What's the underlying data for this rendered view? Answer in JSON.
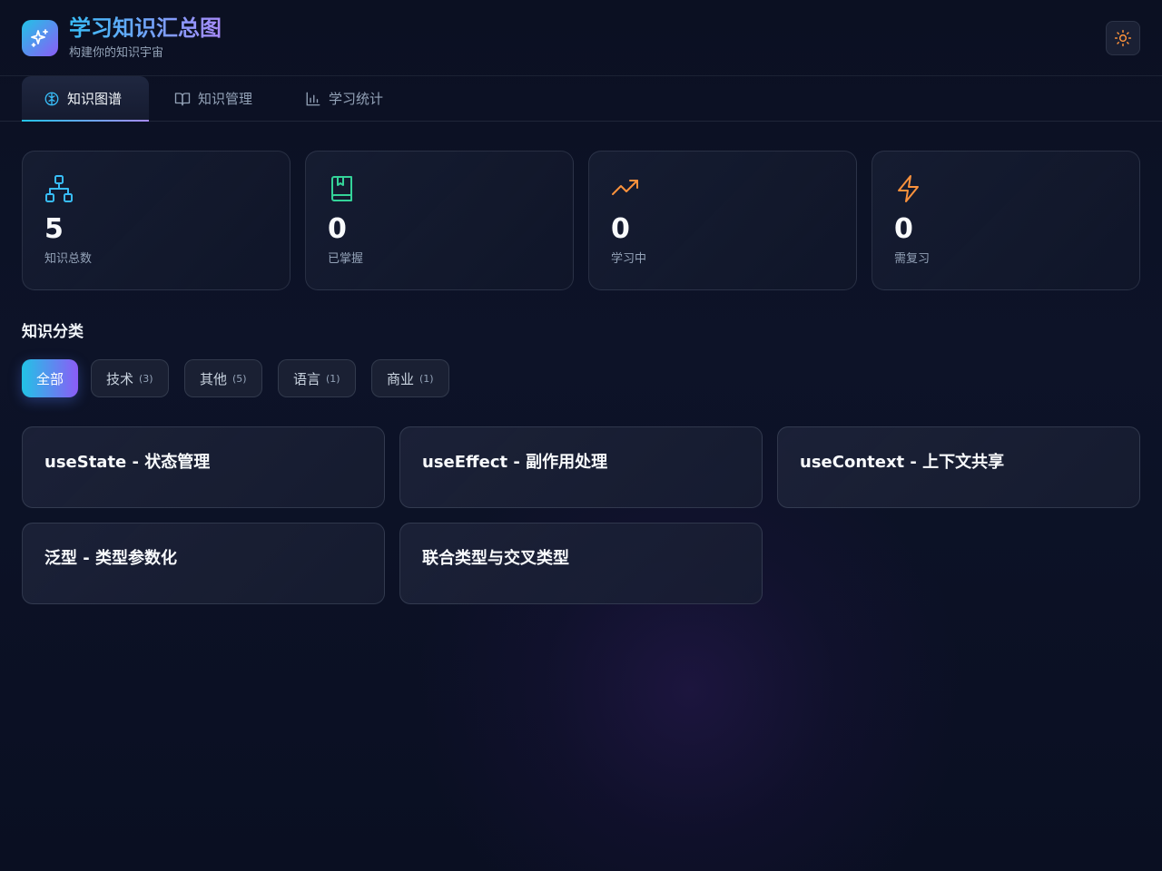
{
  "header": {
    "title": "学习知识汇总图",
    "subtitle": "构建你的知识宇宙",
    "logo_icon": "sparkles-icon",
    "theme_icon": "sun-icon"
  },
  "tabs": [
    {
      "label": "知识图谱",
      "icon": "brain-icon",
      "active": true
    },
    {
      "label": "知识管理",
      "icon": "book-open-icon",
      "active": false
    },
    {
      "label": "学习统计",
      "icon": "bar-chart-icon",
      "active": false
    }
  ],
  "stats": [
    {
      "value": "5",
      "label": "知识总数",
      "icon": "network-icon",
      "color": "#38bdf8"
    },
    {
      "value": "0",
      "label": "已掌握",
      "icon": "book-marked-icon",
      "color": "#34d399"
    },
    {
      "value": "0",
      "label": "学习中",
      "icon": "trending-up-icon",
      "color": "#fb923c"
    },
    {
      "value": "0",
      "label": "需复习",
      "icon": "zap-icon",
      "color": "#fb923c"
    }
  ],
  "categories": {
    "title": "知识分类",
    "items": [
      {
        "label": "全部",
        "count": ""
      },
      {
        "label": "技术",
        "count": "(3)"
      },
      {
        "label": "其他",
        "count": "(5)"
      },
      {
        "label": "语言",
        "count": "(1)"
      },
      {
        "label": "商业",
        "count": "(1)"
      }
    ]
  },
  "cards": [
    {
      "title": "useState - 状态管理"
    },
    {
      "title": "useEffect - 副作用处理"
    },
    {
      "title": "useContext - 上下文共享"
    },
    {
      "title": "泛型 - 类型参数化"
    },
    {
      "title": "联合类型与交叉类型"
    }
  ]
}
